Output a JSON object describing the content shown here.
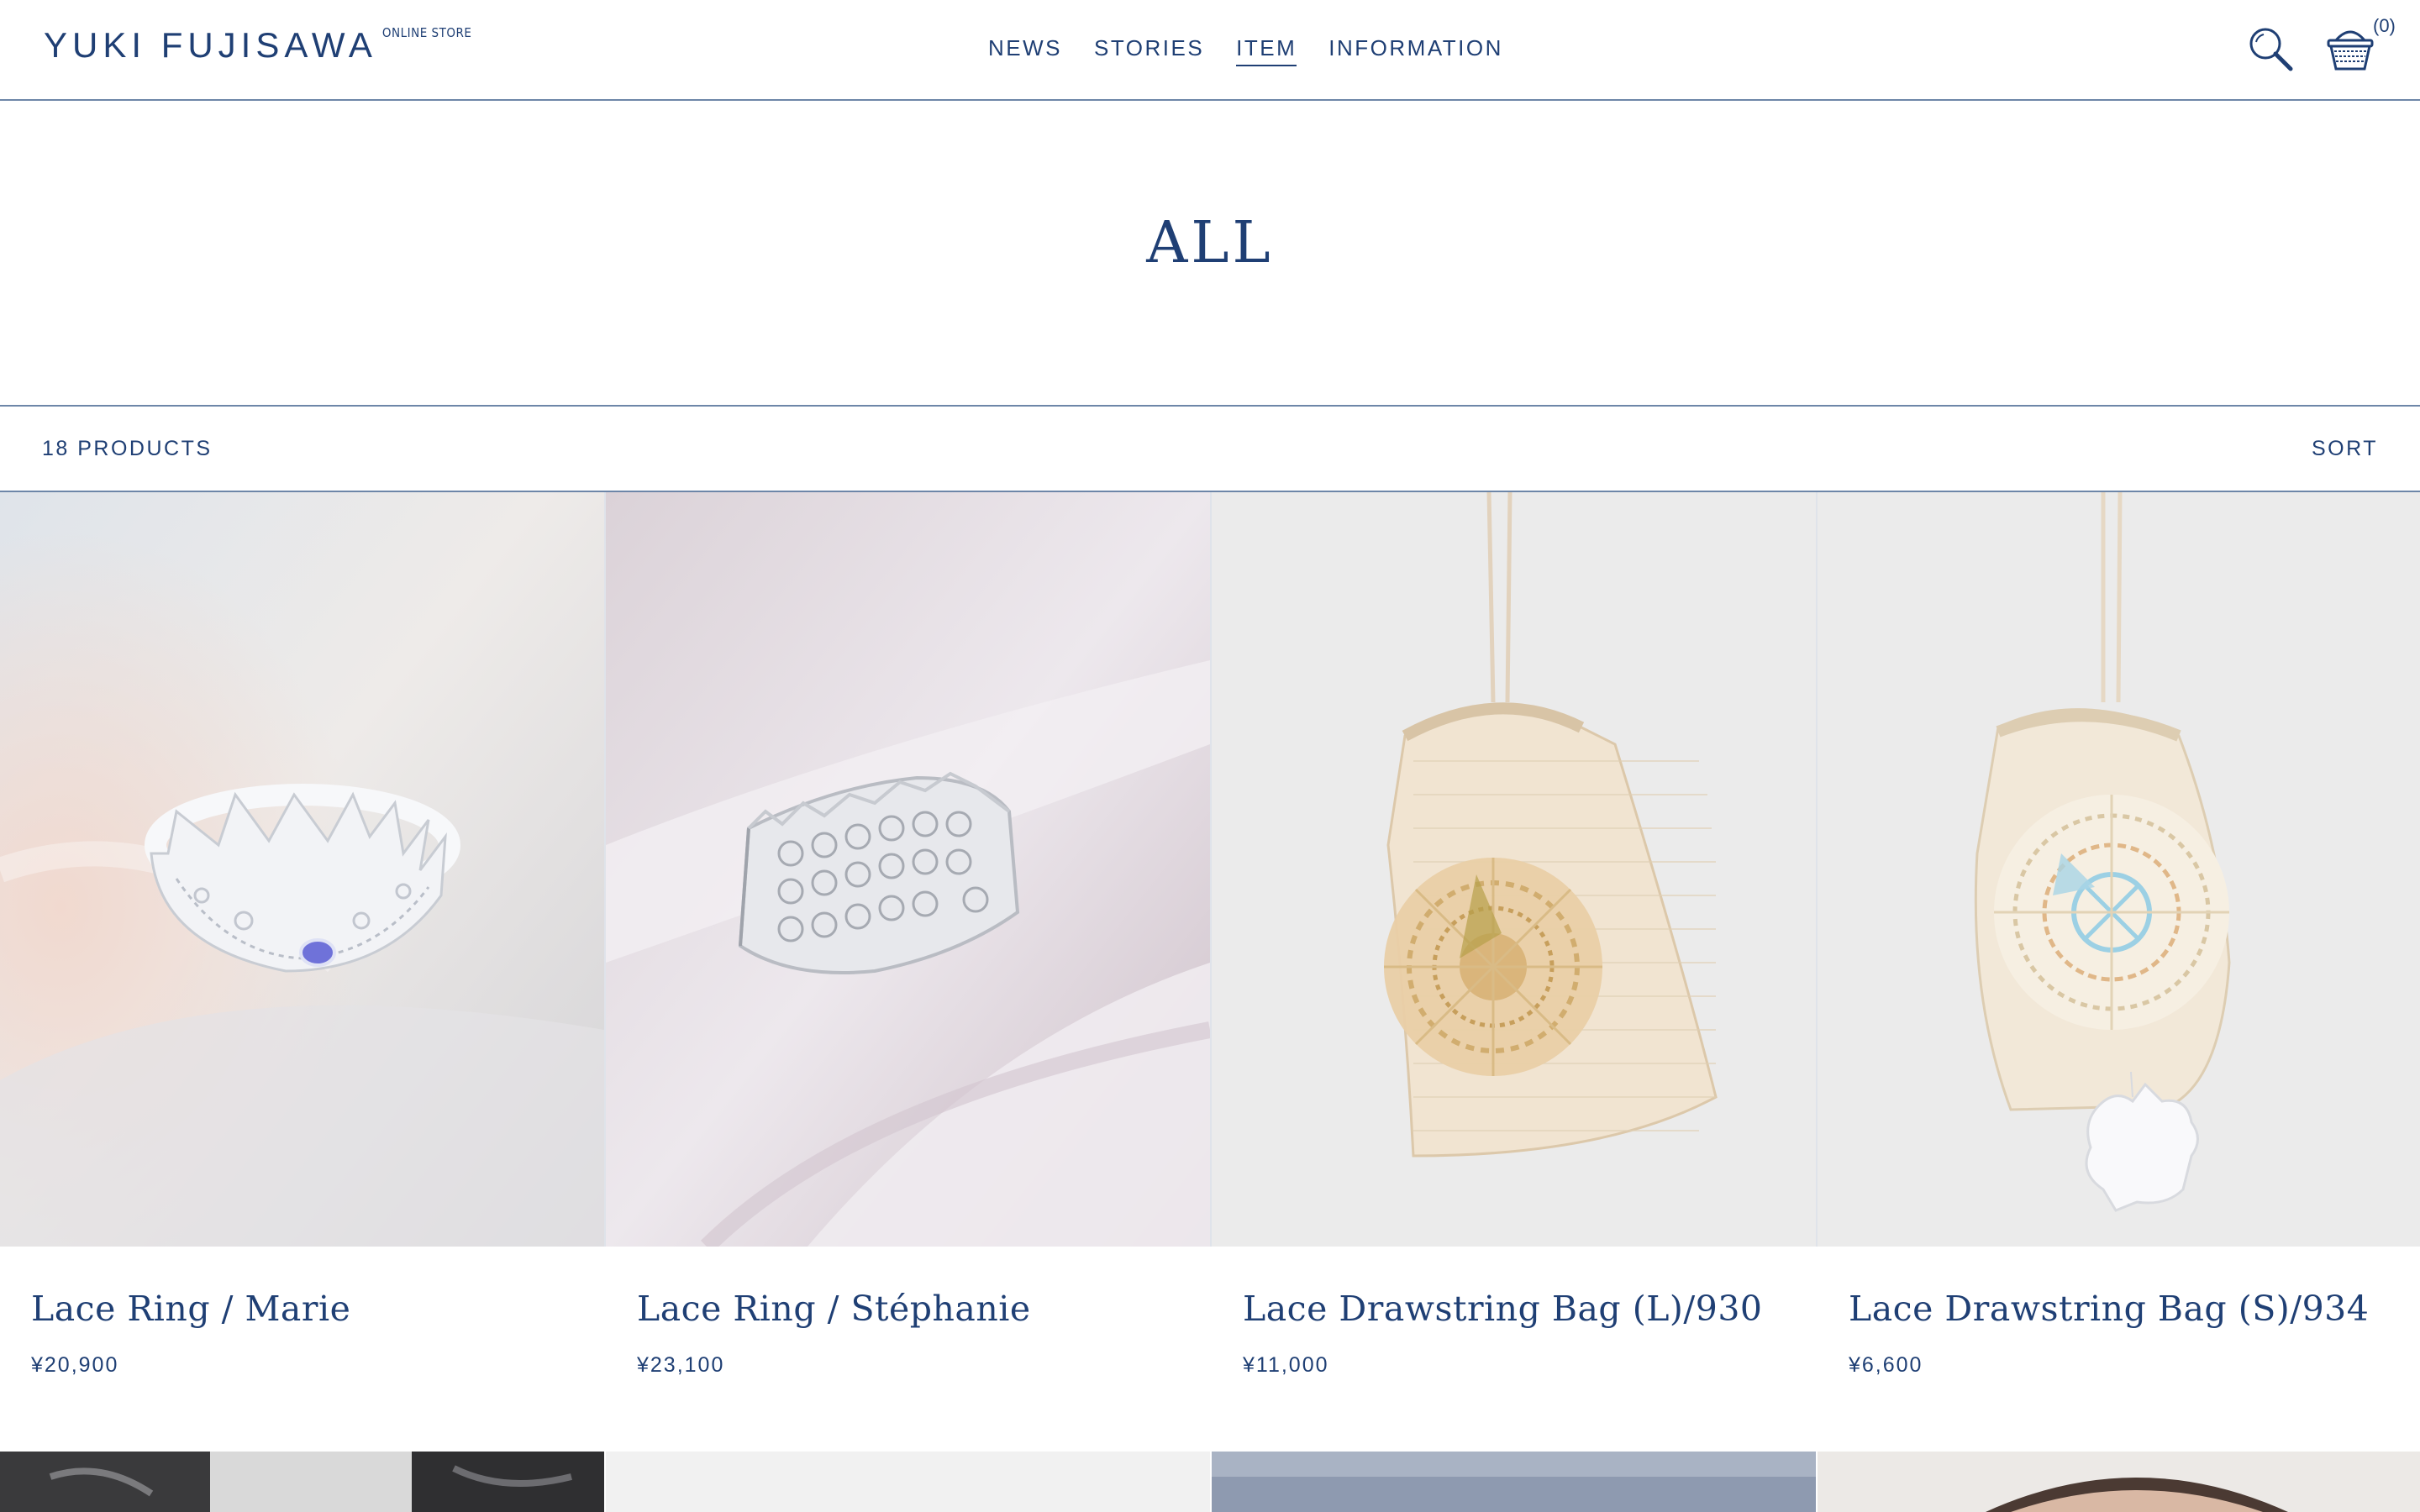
{
  "header": {
    "brand": "YUKI FUJISAWA",
    "brand_sub": "ONLINE STORE",
    "nav": [
      {
        "label": "NEWS"
      },
      {
        "label": "STORIES"
      },
      {
        "label": "ITEM"
      },
      {
        "label": "INFORMATION"
      }
    ],
    "active_nav": "ITEM",
    "cart_count": "(0)"
  },
  "page_title": "ALL",
  "toolbar": {
    "count_label": "18 PRODUCTS",
    "sort_label": "SORT"
  },
  "products": [
    {
      "name": "Lace Ring / Marie",
      "price": "¥20,900"
    },
    {
      "name": "Lace Ring / Stéphanie",
      "price": "¥23,100"
    },
    {
      "name": "Lace Drawstring Bag (L)/930",
      "price": "¥11,000"
    },
    {
      "name": "Lace Drawstring Bag (S)/934",
      "price": "¥6,600"
    }
  ],
  "colors": {
    "accent": "#1f3f74",
    "rule": "#6d86a8"
  }
}
